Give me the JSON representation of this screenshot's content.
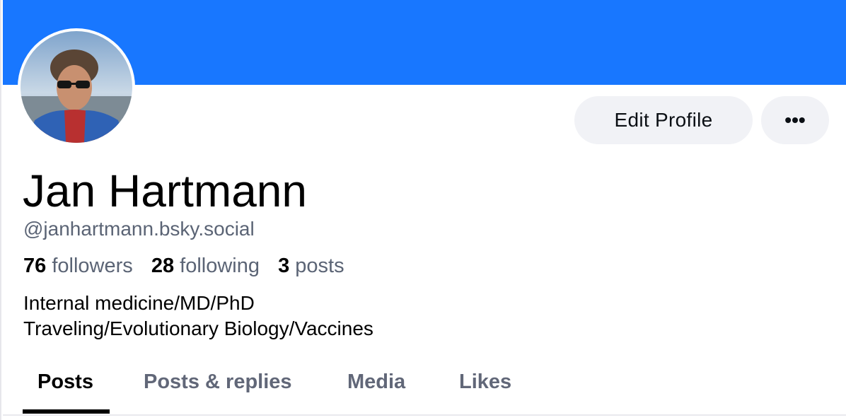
{
  "profile": {
    "name": "Jan Hartmann",
    "handle": "@janhartmann.bsky.social",
    "stats": {
      "followers_count": "76",
      "followers_label": "followers",
      "following_count": "28",
      "following_label": "following",
      "posts_count": "3",
      "posts_label": "posts"
    },
    "bio_lines": [
      "Internal medicine/MD/PhD",
      "Traveling/Evolutionary Biology/Vaccines"
    ]
  },
  "actions": {
    "edit_label": "Edit Profile",
    "more_label": "•••"
  },
  "tabs": [
    {
      "label": "Posts",
      "active": true
    },
    {
      "label": "Posts & replies",
      "active": false
    },
    {
      "label": "Media",
      "active": false
    },
    {
      "label": "Likes",
      "active": false
    }
  ],
  "colors": {
    "banner": "#1877ff",
    "button_bg": "#f1f2f6",
    "muted_text": "#5b6475"
  }
}
